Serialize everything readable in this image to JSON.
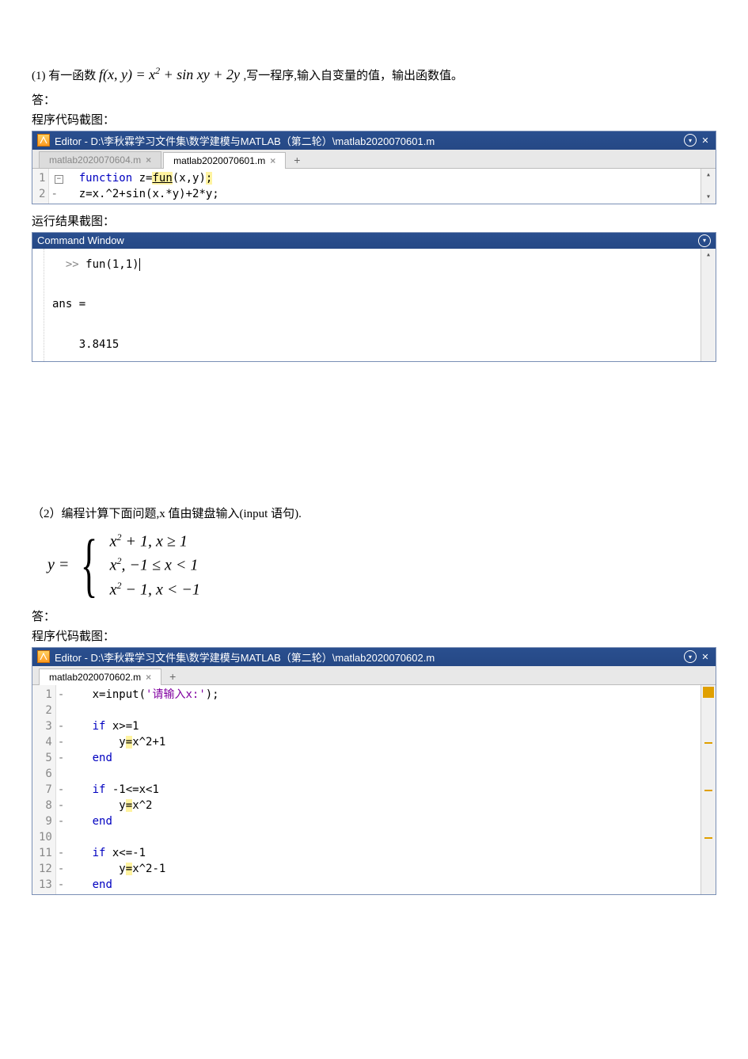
{
  "q1": {
    "prefix": "(1) 有一函数 ",
    "formula_html": "f(x, y) = x² + sin xy + 2y",
    "suffix": " ,写一程序,输入自变量的值，输出函数值。",
    "answer_label": "答：",
    "code_caption": "程序代码截图：",
    "result_caption": "运行结果截图："
  },
  "editor1": {
    "title": "Editor - D:\\李秋霖学习文件集\\数学建模与MATLAB（第二轮）\\matlab2020070601.m",
    "tabs": [
      {
        "label": "matlab2020070604.m",
        "active": false
      },
      {
        "label": "matlab2020070601.m",
        "active": true
      }
    ],
    "gutter": [
      "1",
      "2"
    ],
    "dashes": [
      " ",
      "-"
    ],
    "code": {
      "line1_kw": "function",
      "line1_rest": " z=",
      "line1_fn": "fun",
      "line1_after": "(x,y)",
      "line1_semi": ";",
      "line2": "z=x.^2+sin(x.*y)+2*y;"
    }
  },
  "cmdwin": {
    "title": "Command Window",
    "prompt": ">>",
    "call": "fun(1,1)",
    "ans_label": "ans =",
    "ans_value": "    3.8415"
  },
  "q2": {
    "text": "（2）编程计算下面问题,x 值由键盘输入(input 语句).",
    "yeq": "y =",
    "cases": [
      "x² + 1, x ≥ 1",
      "x², −1 ≤ x < 1",
      "x² − 1, x < −1"
    ],
    "answer_label": "答：",
    "code_caption": "程序代码截图："
  },
  "editor2": {
    "title": "Editor - D:\\李秋霖学习文件集\\数学建模与MATLAB（第二轮）\\matlab2020070602.m",
    "tabs": [
      {
        "label": "matlab2020070602.m",
        "active": true
      }
    ],
    "gutter": [
      "1",
      "2",
      "3",
      "4",
      "5",
      "6",
      "7",
      "8",
      "9",
      "10",
      "11",
      "12",
      "13"
    ],
    "dashes": [
      "-",
      " ",
      "-",
      "-",
      "-",
      " ",
      "-",
      "-",
      "-",
      " ",
      "-",
      "-",
      "-"
    ],
    "code": {
      "l1a": "x=input(",
      "l1s": "'请输入x:'",
      "l1b": ");",
      "l3_if": "if",
      "l3_cond": " x>=1",
      "l4": "    y",
      "l4_eq": "=",
      "l4_rest": "x^2+1",
      "l5_end": "end",
      "l7_if": "if",
      "l7_cond": " -1<=x<1",
      "l8": "    y",
      "l8_eq": "=",
      "l8_rest": "x^2",
      "l9_end": "end",
      "l11_if": "if",
      "l11_cond": " x<=-1",
      "l12": "    y",
      "l12_eq": "=",
      "l12_rest": "x^2-1",
      "l13_end": "end"
    }
  }
}
